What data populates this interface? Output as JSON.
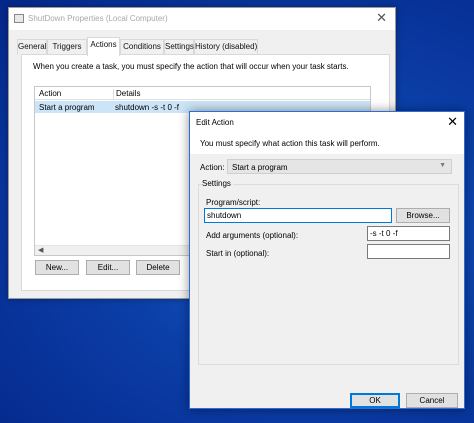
{
  "main_window": {
    "title": "ShutDown Properties (Local Computer)",
    "tabs": [
      {
        "label": "General"
      },
      {
        "label": "Triggers"
      },
      {
        "label": "Actions"
      },
      {
        "label": "Conditions"
      },
      {
        "label": "Settings"
      },
      {
        "label": "History (disabled)"
      }
    ],
    "active_tab": "Actions",
    "instruction": "When you create a task, you must specify the action that will occur when your task starts.",
    "list": {
      "columns": [
        "Action",
        "Details"
      ],
      "rows": [
        {
          "action": "Start a program",
          "details": "shutdown -s -t 0 -f"
        }
      ]
    },
    "buttons": {
      "new": "New...",
      "edit": "Edit...",
      "delete": "Delete"
    }
  },
  "dialog": {
    "title": "Edit Action",
    "message": "You must specify what action this task will perform.",
    "action_label": "Action:",
    "action_value": "Start a program",
    "settings_label": "Settings",
    "program_label": "Program/script:",
    "program_value": "shutdown",
    "browse_label": "Browse...",
    "args_label": "Add arguments (optional):",
    "args_value": "-s -t 0 -f",
    "startin_label": "Start in (optional):",
    "startin_value": "",
    "ok_label": "OK",
    "cancel_label": "Cancel"
  },
  "colors": {
    "desktop": "#0b3fa8",
    "accent": "#0078d7",
    "selection": "#cce4f7"
  }
}
